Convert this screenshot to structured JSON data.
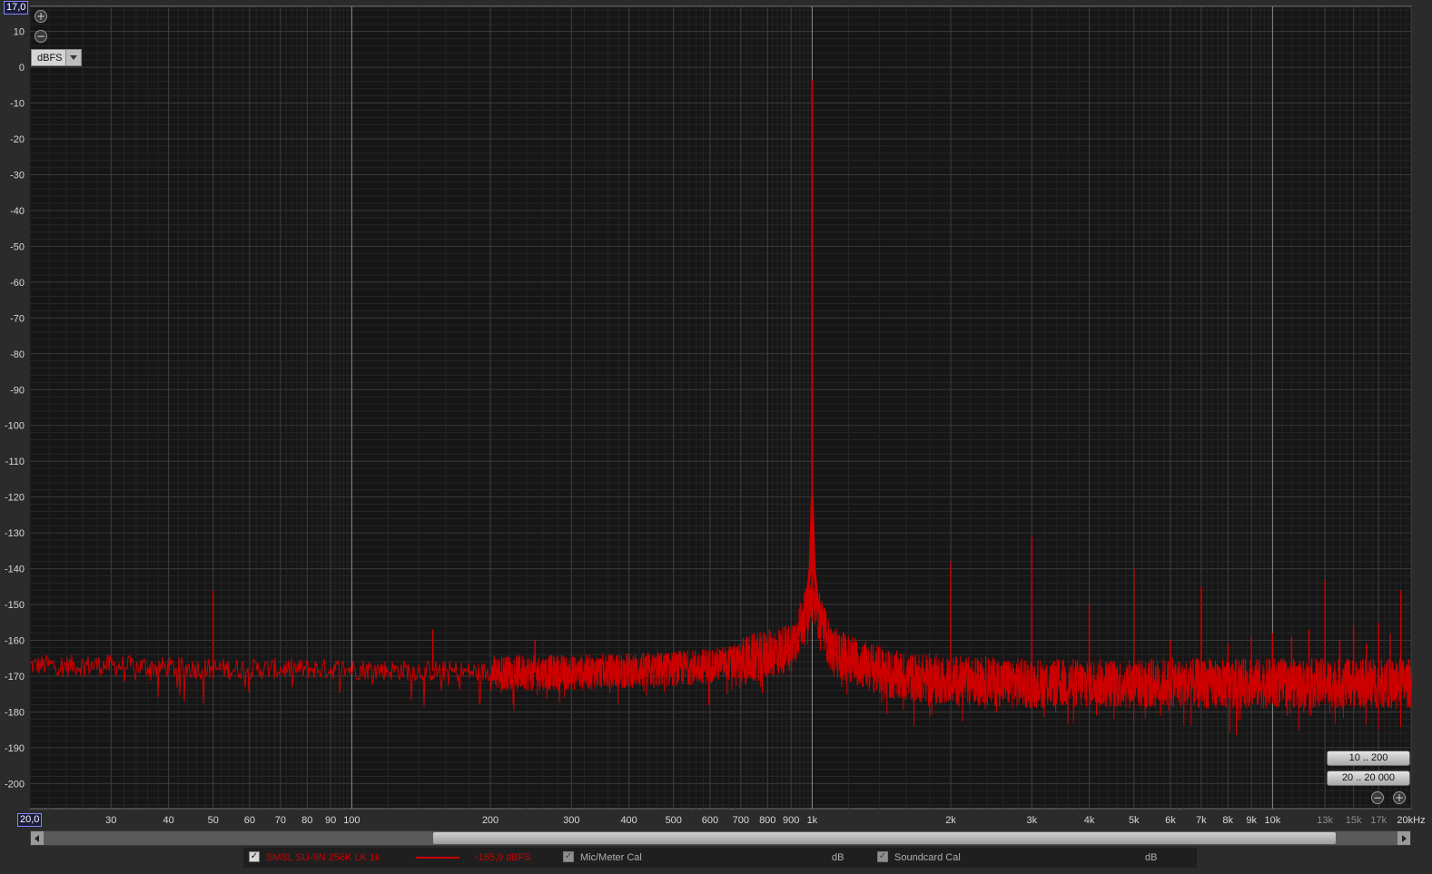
{
  "axes": {
    "y_top_box": "17,0",
    "x_left_box": "20,0",
    "unit": "dBFS",
    "y_ticks": [
      "10",
      "0",
      "-10",
      "-20",
      "-30",
      "-40",
      "-50",
      "-60",
      "-70",
      "-80",
      "-90",
      "-100",
      "-110",
      "-120",
      "-130",
      "-140",
      "-150",
      "-160",
      "-170",
      "-180",
      "-190",
      "-200"
    ],
    "x_ticks": [
      "30",
      "40",
      "50",
      "60",
      "70",
      "80",
      "90",
      "100",
      "200",
      "300",
      "400",
      "500",
      "600",
      "700",
      "800",
      "900",
      "1k",
      "2k",
      "3k",
      "4k",
      "5k",
      "6k",
      "7k",
      "8k",
      "9k",
      "10k",
      "13k",
      "15k",
      "17k",
      "20kHz"
    ]
  },
  "range_buttons": {
    "low": "10 .. 200",
    "full": "20 .. 20 000"
  },
  "icons": {
    "zoom_in": "plus-circle-icon",
    "zoom_out": "minus-circle-icon",
    "dropdown": "chevron-down-icon",
    "scroll_left": "arrow-left-icon",
    "scroll_right": "arrow-right-icon"
  },
  "legend": {
    "trace_name": "SMSL SU-9N 256K LK 1k",
    "trace_value": "-165,9 dBFS",
    "mic_cal": "Mic/Meter Cal",
    "mic_unit": "dB",
    "soundcard_cal": "Soundcard Cal",
    "soundcard_unit": "dB",
    "trace_color": "#cc0000"
  },
  "chart_data": {
    "type": "line",
    "x_scale": "log",
    "xlim": [
      20,
      20000
    ],
    "ylim": [
      -207,
      17
    ],
    "xlabel": "",
    "ylabel": "",
    "grid": true,
    "series": [
      {
        "name": "SMSL SU-9N 256K LK 1k",
        "color": "#cc0000",
        "noise_floor": [
          [
            20,
            -167
          ],
          [
            30,
            -167
          ],
          [
            50,
            -168
          ],
          [
            100,
            -168
          ],
          [
            200,
            -169
          ],
          [
            300,
            -169
          ],
          [
            500,
            -168
          ],
          [
            700,
            -166
          ],
          [
            900,
            -162
          ],
          [
            1000,
            -148
          ],
          [
            1100,
            -163
          ],
          [
            1500,
            -170
          ],
          [
            2000,
            -171
          ],
          [
            3000,
            -172
          ],
          [
            5000,
            -172
          ],
          [
            10000,
            -172
          ],
          [
            20000,
            -172
          ]
        ],
        "peaks": [
          {
            "x": 50,
            "y": -146
          },
          {
            "x": 150,
            "y": -157
          },
          {
            "x": 250,
            "y": -160
          },
          {
            "x": 1000,
            "y": -3.5
          },
          {
            "x": 2000,
            "y": -138
          },
          {
            "x": 3000,
            "y": -131
          },
          {
            "x": 4000,
            "y": -150
          },
          {
            "x": 5000,
            "y": -140
          },
          {
            "x": 6000,
            "y": -160
          },
          {
            "x": 7000,
            "y": -145
          },
          {
            "x": 8000,
            "y": -161
          },
          {
            "x": 9000,
            "y": -159
          },
          {
            "x": 10000,
            "y": -158
          },
          {
            "x": 11000,
            "y": -159
          },
          {
            "x": 12000,
            "y": -157
          },
          {
            "x": 13000,
            "y": -143
          },
          {
            "x": 14000,
            "y": -160
          },
          {
            "x": 15000,
            "y": -156
          },
          {
            "x": 16000,
            "y": -161
          },
          {
            "x": 17000,
            "y": -155
          },
          {
            "x": 18000,
            "y": -158
          },
          {
            "x": 19000,
            "y": -146
          }
        ]
      }
    ]
  }
}
